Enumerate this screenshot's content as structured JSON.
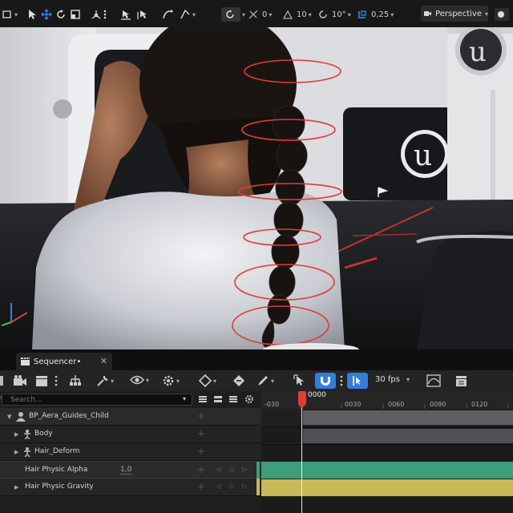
{
  "toolbar": {
    "position_snap_value": "0",
    "rotation_snap_value": "10",
    "angle_snap_value": "10°",
    "scale_snap_value": "0,25",
    "viewport_mode_label": "Perspective"
  },
  "sequencer": {
    "tab_title": "Sequencer•",
    "fps_label": "30 fps",
    "search_placeholder": "Search...",
    "current_frame": "0000",
    "ruler_labels": [
      "-030",
      "0000",
      "0030",
      "0060",
      "0090",
      "0120"
    ],
    "tracks": [
      {
        "label": "BP_Aera_Guides_Child",
        "level": 0
      },
      {
        "label": "Body",
        "level": 1
      },
      {
        "label": "Hair_Deform",
        "level": 1
      },
      {
        "label": "Hair Physic Alpha",
        "level": 2,
        "value": "1,0"
      },
      {
        "label": "Hair Physic Gravity",
        "level": 2
      }
    ]
  },
  "colors": {
    "accent_blue": "#2f7fe0",
    "playhead_red": "#e23b3b",
    "track_green": "#3d9e78",
    "track_yellow": "#c9b857",
    "binding_gray": "#5f5f63"
  }
}
